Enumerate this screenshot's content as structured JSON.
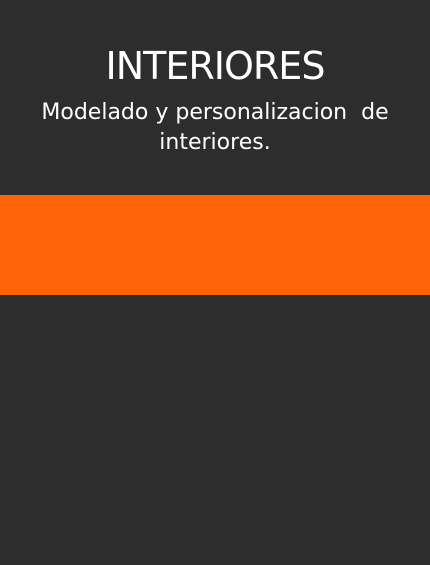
{
  "card": {
    "title": "INTERIORES",
    "subtitle": "Modelado y personalizacion  de interiores.",
    "colors": {
      "background": "#2d2d2d",
      "accent": "#ff6308",
      "text": "#ffffff"
    }
  }
}
